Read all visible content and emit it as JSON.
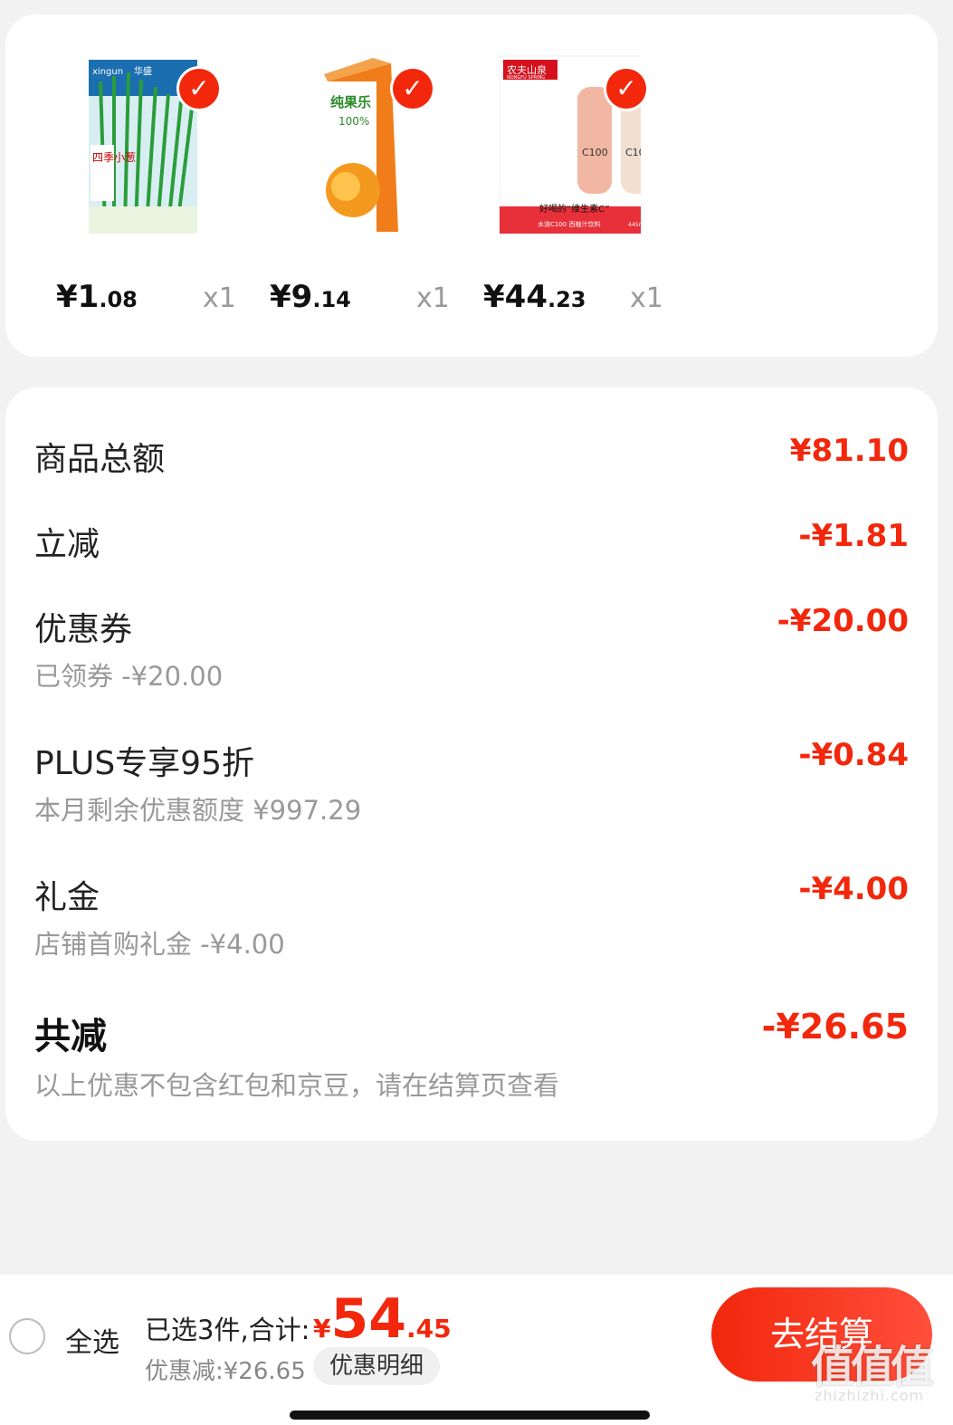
{
  "products": [
    {
      "price_int": "¥1",
      "price_dec": ".08",
      "qty": "x1",
      "name": "四季小葱",
      "brand": "华盛",
      "image_text": "xingun"
    },
    {
      "price_int": "¥9",
      "price_dec": ".14",
      "qty": "x1",
      "name": "纯果乐",
      "volume": "100%"
    },
    {
      "price_int": "¥44",
      "price_dec": ".23",
      "qty": "x1",
      "brand": "农夫山泉",
      "brand_en": "NONGFU SPRING",
      "slogan": "好喝的“维生素C”",
      "product": "水溶C100",
      "small": "水溶C100 西柚汁饮料",
      "size": "445ml*15瓶",
      "label": "C100"
    }
  ],
  "summary": {
    "goods_total_label": "商品总额",
    "goods_total_value": "¥81.10",
    "instant_label": "立减",
    "instant_value": "-¥1.81",
    "coupon_label": "优惠券",
    "coupon_value": "-¥20.00",
    "coupon_sub": "已领券 -¥20.00",
    "plus_label": "PLUS专享95折",
    "plus_value": "-¥0.84",
    "plus_sub": "本月剩余优惠额度 ¥997.29",
    "gift_label": "礼金",
    "gift_value": "-¥4.00",
    "gift_sub": "店铺首购礼金 -¥4.00",
    "total_label": "共减",
    "total_value": "-¥26.65",
    "total_sub": "以上优惠不包含红包和京豆，请在结算页查看"
  },
  "bottom_bar": {
    "select_all": "全选",
    "selected": "已选3件,合计:",
    "price_symbol": "¥",
    "price_int": "54",
    "price_dec": ".45",
    "discount": "优惠减:¥26.65",
    "detail_button": "优惠明细",
    "checkout": "去结算",
    "watermark": "值值值",
    "watermark_url": "zhizhizhi.com"
  },
  "colors": {
    "accent": "#f2270c",
    "background": "#f2f2f2"
  }
}
